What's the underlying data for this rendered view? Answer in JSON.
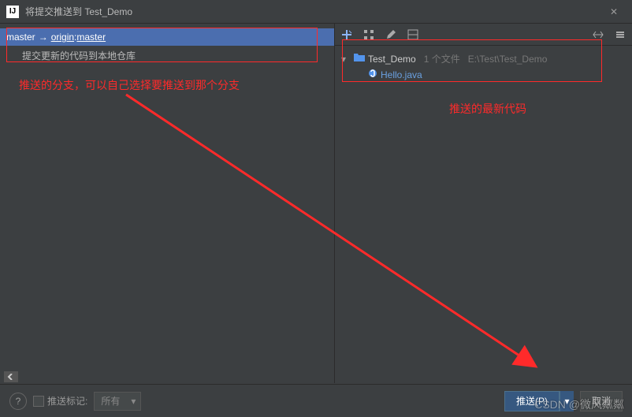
{
  "titlebar": {
    "icon_label": "IJ",
    "title": "将提交推送到 Test_Demo",
    "close_label": "✕"
  },
  "left": {
    "branch_local": "master",
    "arrow_glyph": "→",
    "branch_remote": "origin",
    "branch_sep": " : ",
    "branch_target": "master",
    "commit_msg": "提交更新的代码到本地仓库"
  },
  "annotations": {
    "left": "推送的分支，可以自己选择要推送到那个分支",
    "right": "推送的最新代码"
  },
  "right": {
    "toolbar_icons": [
      "add-icon",
      "grid-icon",
      "edit-icon",
      "tile-icon",
      "expand-icon",
      "settings-icon"
    ],
    "tree": {
      "expand_glyph": "▾",
      "folder_glyph": "▮",
      "project_name": "Test_Demo",
      "file_count": "1 个文件",
      "project_path": "E:\\Test\\Test_Demo",
      "file_glyph": "◐",
      "file_name": "Hello.java"
    }
  },
  "bottom": {
    "help_glyph": "?",
    "checkbox_label": "推送标记:",
    "dropdown_value": "所有",
    "push_label": "推送(P)",
    "push_caret": "▾",
    "cancel_label": "取消"
  },
  "watermark": "CSDN @微风粼粼",
  "colors": {
    "selected_bg": "#4b6eaf",
    "accent_red": "#ff2a2a",
    "primary_btn": "#365880"
  }
}
